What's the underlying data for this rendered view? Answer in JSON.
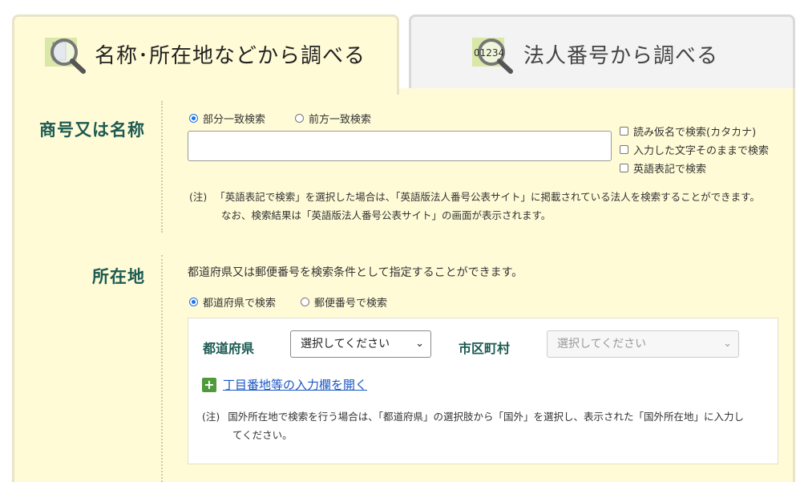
{
  "tabs": [
    {
      "label": "名称･所在地などから調べる",
      "icon": "building-magnifier-icon",
      "active": true
    },
    {
      "label": "法人番号から調べる",
      "icon": "number-magnifier-icon",
      "icon_text": "01234",
      "active": false
    }
  ],
  "name_section": {
    "label": "商号又は名称",
    "radios": [
      {
        "label": "部分一致検索",
        "checked": true
      },
      {
        "label": "前方一致検索",
        "checked": false
      }
    ],
    "input_value": "",
    "checkboxes": [
      {
        "label": "読み仮名で検索(カタカナ)",
        "checked": false
      },
      {
        "label": "入力した文字そのままで検索",
        "checked": false
      },
      {
        "label": "英語表記で検索",
        "checked": false
      }
    ],
    "note_prefix": "(注)",
    "note_line1": "「英語表記で検索」を選択した場合は、「英語版法人番号公表サイト」に掲載されている法人を検索することができます。",
    "note_line2": "なお、検索結果は「英語版法人番号公表サイト」の画面が表示されます。"
  },
  "location_section": {
    "label": "所在地",
    "description": "都道府県又は郵便番号を検索条件として指定することができます。",
    "radios": [
      {
        "label": "都道府県で検索",
        "checked": true
      },
      {
        "label": "郵便番号で検索",
        "checked": false
      }
    ],
    "prefecture_label": "都道府県",
    "prefecture_select": "選択してください",
    "city_label": "市区町村",
    "city_select": "選択してください",
    "expand_link": "丁目番地等の入力欄を開く",
    "note_prefix": "(注)",
    "note_line1": "国外所在地で検索を行う場合は、「都道府県」の選択肢から「国外」を選択し、表示された「国外所在地」に入力し",
    "note_line2": "てください。"
  },
  "colors": {
    "panel_bg": "#fffbd7",
    "label_teal": "#1c5a52",
    "link_blue": "#1a56c4",
    "plus_green": "#4f9a3a"
  }
}
